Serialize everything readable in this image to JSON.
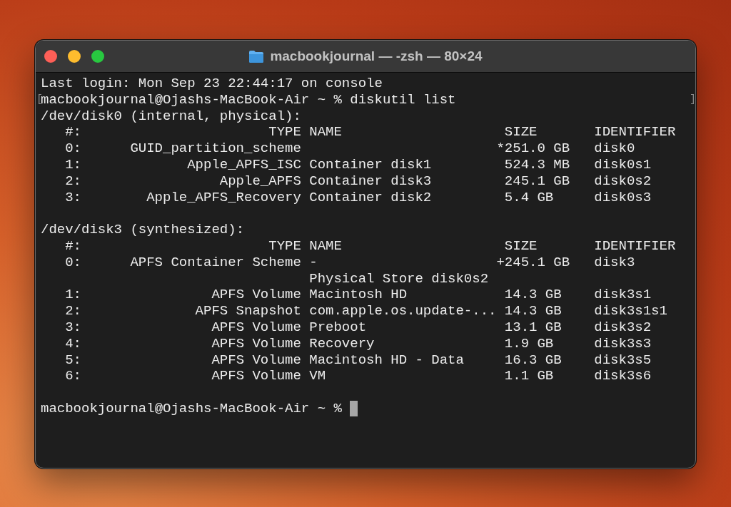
{
  "window": {
    "title": "macbookjournal — -zsh — 80×24",
    "controls": [
      {
        "kind": "close"
      },
      {
        "kind": "minimize"
      },
      {
        "kind": "zoom"
      }
    ]
  },
  "terminal": {
    "login": "Last login: Mon Sep 23 22:44:17 on console",
    "command_line": {
      "text": "macbookjournal@Ojashs-MacBook-Air ~ % diskutil list",
      "mark_open": "[",
      "mark_close": "]"
    },
    "disks": [
      {
        "heading": "/dev/disk0 (internal, physical):",
        "columns": [
          "#:",
          "TYPE",
          "NAME",
          "SIZE",
          "IDENTIFIER"
        ],
        "rows": [
          {
            "index": "0:",
            "type": "GUID_partition_scheme",
            "size_prefix": "*",
            "size": "251.0 GB",
            "identifier": "disk0"
          },
          {
            "index": "1:",
            "type": "Apple_APFS_ISC",
            "name": "Container disk1",
            "size": "524.3 MB",
            "identifier": "disk0s1"
          },
          {
            "index": "2:",
            "type": "Apple_APFS",
            "name": "Container disk3",
            "size": "245.1 GB",
            "identifier": "disk0s2"
          },
          {
            "index": "3:",
            "type": "Apple_APFS_Recovery",
            "name": "Container disk2",
            "size": "5.4 GB",
            "identifier": "disk0s3"
          }
        ]
      },
      {
        "heading": "/dev/disk3 (synthesized):",
        "columns": [
          "#:",
          "TYPE",
          "NAME",
          "SIZE",
          "IDENTIFIER"
        ],
        "rows": [
          {
            "index": "0:",
            "type": "APFS Container Scheme",
            "name": "-",
            "size_prefix": "+",
            "size": "245.1 GB",
            "identifier": "disk3"
          },
          {
            "name": "Physical Store disk0s2"
          },
          {
            "index": "1:",
            "type": "APFS Volume",
            "name": "Macintosh HD",
            "size": "14.3 GB",
            "identifier": "disk3s1"
          },
          {
            "index": "2:",
            "type": "APFS Snapshot",
            "name": "com.apple.os.update-...",
            "size": "14.3 GB",
            "identifier": "disk3s1s1"
          },
          {
            "index": "3:",
            "type": "APFS Volume",
            "name": "Preboot",
            "size": "13.1 GB",
            "identifier": "disk3s2"
          },
          {
            "index": "4:",
            "type": "APFS Volume",
            "name": "Recovery",
            "size": "1.9 GB",
            "identifier": "disk3s3"
          },
          {
            "index": "5:",
            "type": "APFS Volume",
            "name": "Macintosh HD - Data",
            "size": "16.3 GB",
            "identifier": "disk3s5"
          },
          {
            "index": "6:",
            "type": "APFS Volume",
            "name": "VM",
            "size": "1.1 GB",
            "identifier": "disk3s6"
          }
        ]
      }
    ],
    "prompt": {
      "text": "macbookjournal@Ojashs-MacBook-Air ~ %",
      "cursor": true
    }
  }
}
